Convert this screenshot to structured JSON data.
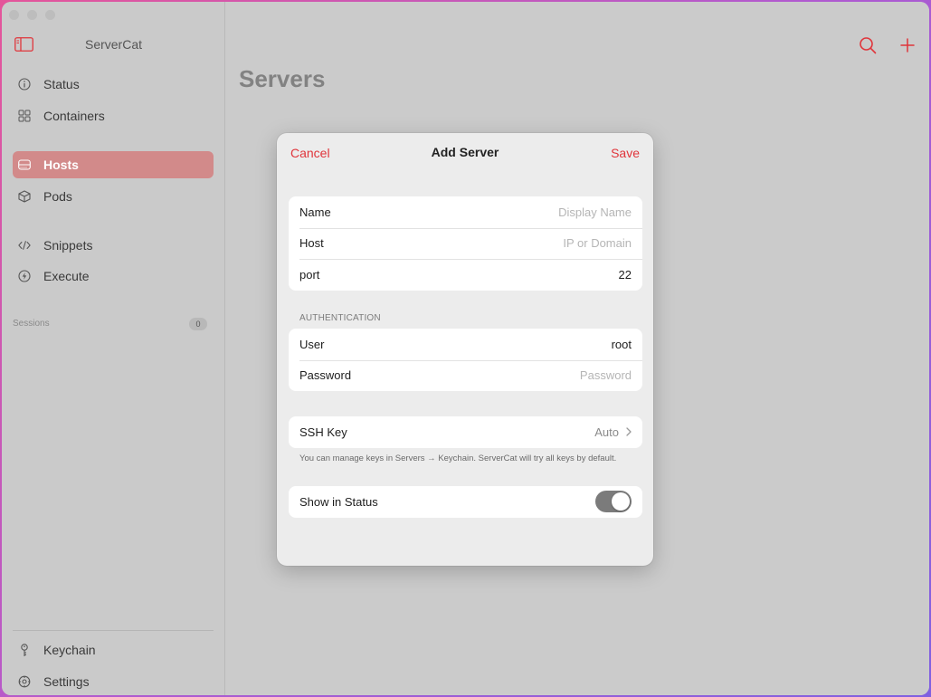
{
  "app": {
    "title": "ServerCat"
  },
  "sidebar": {
    "items": [
      {
        "label": "Status",
        "icon": "info-circle-icon"
      },
      {
        "label": "Containers",
        "icon": "grid-icon"
      },
      {
        "label": "Hosts",
        "icon": "server-icon",
        "active": true
      },
      {
        "label": "Pods",
        "icon": "cube-icon"
      },
      {
        "label": "Snippets",
        "icon": "code-icon"
      },
      {
        "label": "Execute",
        "icon": "bolt-circle-icon"
      }
    ],
    "sessions": {
      "label": "Sessions",
      "count": "0"
    },
    "footer": [
      {
        "label": "Keychain",
        "icon": "key-icon"
      },
      {
        "label": "Settings",
        "icon": "gear-icon"
      }
    ]
  },
  "main": {
    "title": "Servers"
  },
  "modal": {
    "title": "Add Server",
    "cancel_label": "Cancel",
    "save_label": "Save",
    "basic": {
      "name": {
        "label": "Name",
        "value": "",
        "placeholder": "Display Name"
      },
      "host": {
        "label": "Host",
        "value": "",
        "placeholder": "IP or Domain"
      },
      "port": {
        "label": "port",
        "value": "22",
        "placeholder": ""
      }
    },
    "auth": {
      "header": "AUTHENTICATION",
      "user": {
        "label": "User",
        "value": "root",
        "placeholder": ""
      },
      "password": {
        "label": "Password",
        "value": "",
        "placeholder": "Password"
      }
    },
    "ssh": {
      "label": "SSH Key",
      "value": "Auto",
      "note": "You can manage keys in Servers → Keychain. ServerCat will try all keys by default."
    },
    "show_in_status": {
      "label": "Show in Status",
      "enabled": true
    }
  },
  "colors": {
    "accent": "#e0353b",
    "active_item": "#d28a8a"
  }
}
